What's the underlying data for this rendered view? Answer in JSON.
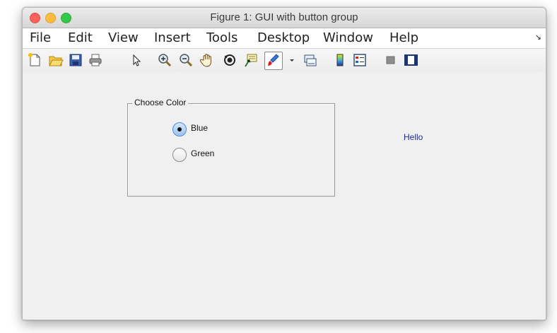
{
  "window": {
    "title": "Figure 1: GUI with button group",
    "traffic_lights": [
      "close",
      "minimize",
      "maximize"
    ]
  },
  "menubar": {
    "items": [
      "File",
      "Edit",
      "View",
      "Insert",
      "Tools",
      "Desktop",
      "Window",
      "Help"
    ],
    "dock_icon": "dock-arrow-icon"
  },
  "toolbar": {
    "icons": [
      "new-figure-icon",
      "open-file-icon",
      "save-icon",
      "print-icon",
      "pointer-icon",
      "zoom-in-icon",
      "zoom-out-icon",
      "pan-hand-icon",
      "rotate-3d-icon",
      "data-cursor-icon",
      "brush-icon",
      "brush-dropdown-icon",
      "link-plot-icon",
      "colorbar-icon",
      "legend-icon",
      "hide-plot-tools-icon",
      "show-plot-tools-icon"
    ]
  },
  "panel": {
    "title": "Choose Color",
    "options": [
      {
        "label": "Blue",
        "selected": true
      },
      {
        "label": "Green",
        "selected": false
      }
    ]
  },
  "text_label": {
    "text": "Hello",
    "color": "#1f2a9c"
  },
  "colors": {
    "radio_selected": "#9cc4f2",
    "background": "#f0f0f0"
  }
}
